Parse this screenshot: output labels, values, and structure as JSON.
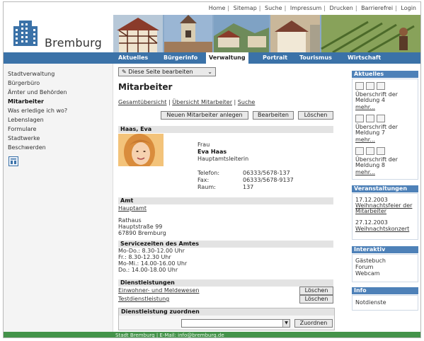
{
  "topnav": {
    "items": [
      "Home",
      "Sitemap",
      "Suche",
      "Impressum",
      "Drucken",
      "Barrierefrei",
      "Login"
    ]
  },
  "brand": {
    "name": "Bremburg"
  },
  "mainnav": {
    "items": [
      "Aktuelles",
      "Bürgerinfo",
      "Verwaltung",
      "Portrait",
      "Tourismus",
      "Wirtschaft"
    ],
    "active": "Verwaltung"
  },
  "leftnav": {
    "items": [
      "Stadtverwaltung",
      "Bürgerbüro",
      "Ämter und Behörden",
      "Mitarbeiter",
      "Was erledige ich wo?",
      "Lebenslagen",
      "Formulare",
      "Stadtwerke",
      "Beschwerden"
    ],
    "active": "Mitarbeiter"
  },
  "main": {
    "edit_button": "Diese Seite bearbeiten",
    "title": "Mitarbeiter",
    "links": [
      "Gesamtübersicht",
      "Übersicht Mitarbeiter",
      "Suche"
    ],
    "actions": {
      "new": "Neuen Mitarbeiter anlegen",
      "edit": "Bearbeiten",
      "delete": "Löschen"
    },
    "person": {
      "header": "Haas, Eva",
      "salutation": "Frau",
      "name": "Eva Haas",
      "role": "Hauptamtsleiterin",
      "phone_label": "Telefon:",
      "phone": "06333/5678-137",
      "fax_label": "Fax:",
      "fax": "06333/5678-9137",
      "room_label": "Raum:",
      "room": "137"
    },
    "amt": {
      "header": "Amt",
      "link": "Hauptamt",
      "address": [
        "Rathaus",
        "Hauptstraße 99",
        "67890 Bremburg"
      ]
    },
    "service": {
      "header": "Servicezeiten des Amtes",
      "lines": [
        "Mo-Do.: 8.30-12.00 Uhr",
        "Fr.: 8.30-12.30 Uhr",
        "Mo-Mi.: 14.00-16.00 Uhr",
        "Do.: 14.00-18.00 Uhr"
      ]
    },
    "dienstleistungen": {
      "header": "Dienstleistungen",
      "items": [
        "Einwohner- und Meldewesen",
        "Testdienstleistung"
      ],
      "delete_label": "Löschen"
    },
    "assign": {
      "header": "Dienstleistung zuordnen",
      "select_value": "",
      "button": "Zuordnen"
    }
  },
  "right": {
    "aktuelles": {
      "header": "Aktuelles",
      "items": [
        {
          "title": "Überschrift der Meldung 4",
          "more": "mehr..."
        },
        {
          "title": "Überschrift der Meldung 7",
          "more": "mehr..."
        },
        {
          "title": "Überschrift der Meldung 8",
          "more": "mehr..."
        }
      ]
    },
    "veranstaltungen": {
      "header": "Veranstaltungen",
      "items": [
        {
          "date": "17.12.2003",
          "title": "Weihnachtsfeier der Mitarbeiter"
        },
        {
          "date": "27.12.2003",
          "title": "Weihnachtskonzert"
        }
      ]
    },
    "interaktiv": {
      "header": "Interaktiv",
      "items": [
        "Gästebuch",
        "Forum",
        "Webcam"
      ]
    },
    "info": {
      "header": "Info",
      "items": [
        "Notdienste"
      ]
    }
  },
  "footer": {
    "text": "Stadt Bremburg | E-Mail: info@bremburg.de"
  },
  "colors": {
    "nav_blue": "#3b72a8",
    "box_blue": "#4e81b8",
    "footer_green": "#44934a"
  }
}
